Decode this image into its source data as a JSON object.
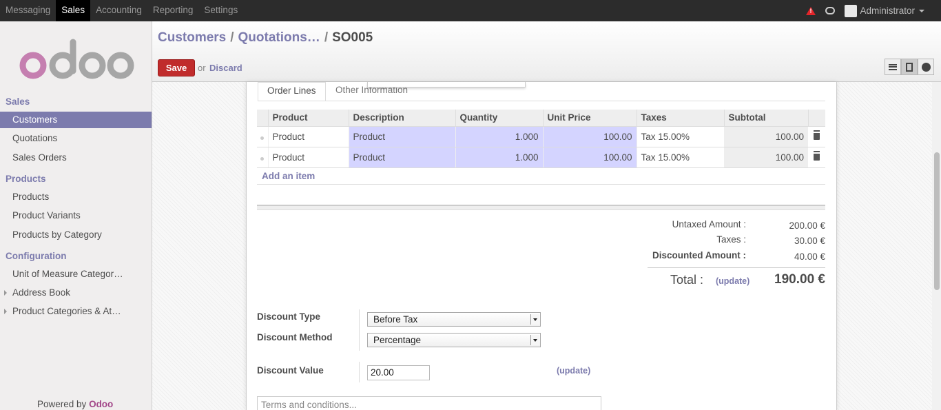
{
  "topbar": {
    "menu": [
      "Messaging",
      "Sales",
      "Accounting",
      "Reporting",
      "Settings"
    ],
    "active_menu": "Sales",
    "user": "Administrator"
  },
  "sidebar": {
    "logo_text": "odoo",
    "sections": [
      {
        "title": "Sales",
        "items": [
          "Customers",
          "Quotations",
          "Sales Orders"
        ]
      },
      {
        "title": "Products",
        "items": [
          "Products",
          "Product Variants",
          "Products by Category"
        ]
      },
      {
        "title": "Configuration",
        "items": [
          "Unit of Measure Categor…",
          "Address Book",
          "Product Categories & At…"
        ]
      }
    ],
    "active_item": "Customers",
    "powered_by": "Powered by",
    "powered_brand": "Odoo"
  },
  "header": {
    "breadcrumbs": [
      "Customers",
      "Quotations…"
    ],
    "separator": "/",
    "current": "SO005",
    "save_label": "Save",
    "or_text": "or",
    "discard_label": "Discard"
  },
  "tabs": [
    "Order Lines",
    "Other Information"
  ],
  "order_lines": {
    "columns": [
      "Product",
      "Description",
      "Quantity",
      "Unit Price",
      "Taxes",
      "Subtotal"
    ],
    "rows": [
      {
        "product": "Product",
        "description": "Product",
        "quantity": "1.000",
        "unit_price": "100.00",
        "taxes": "Tax 15.00%",
        "subtotal": "100.00"
      },
      {
        "product": "Product",
        "description": "Product",
        "quantity": "1.000",
        "unit_price": "100.00",
        "taxes": "Tax 15.00%",
        "subtotal": "100.00"
      }
    ],
    "add_item": "Add an item"
  },
  "totals": {
    "untaxed_label": "Untaxed Amount :",
    "untaxed_value": "200.00 €",
    "taxes_label": "Taxes :",
    "taxes_value": "30.00 €",
    "discounted_label": "Discounted Amount :",
    "discounted_value": "40.00 €",
    "total_label": "Total :",
    "update_label": "(update)",
    "total_value": "190.00 €"
  },
  "discount": {
    "type_label": "Discount Type",
    "type_value": "Before Tax",
    "method_label": "Discount Method",
    "method_value": "Percentage",
    "value_label": "Discount Value",
    "value": "20.00",
    "update_label": "(update)"
  },
  "terms_placeholder": "Terms and conditions...",
  "colors": {
    "accent": "#7c7bad",
    "save": "#c02c2c",
    "editable_cell": "#d4d4ff",
    "topbar": "#2c2c2c"
  }
}
